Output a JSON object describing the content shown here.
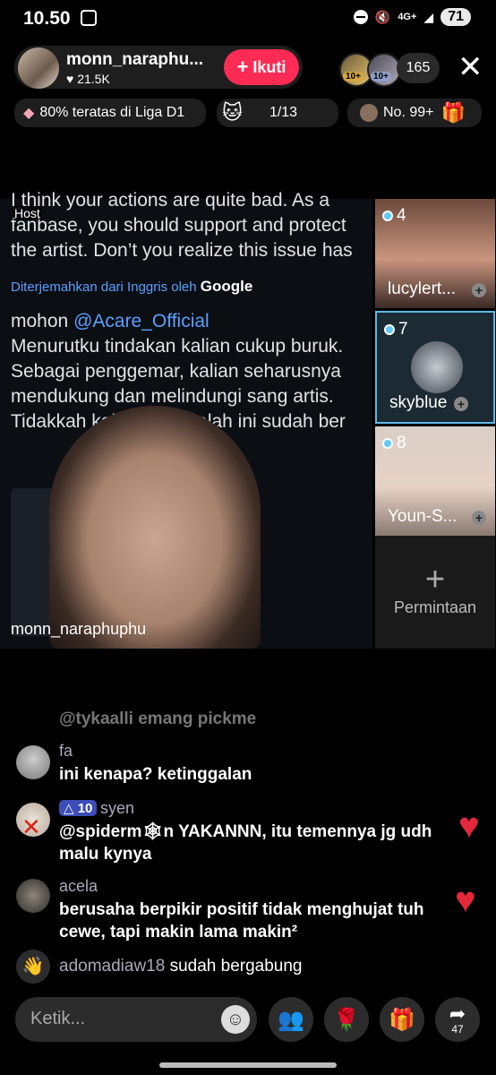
{
  "status_bar": {
    "time": "10.50",
    "signal": "4G+",
    "battery": "71"
  },
  "host": {
    "name": "monn_naraphu...",
    "likes": "21.5K",
    "follow_label": "Ikuti",
    "viewer_count": "165",
    "viewer_badge": "10+"
  },
  "chips": {
    "league": "80% teratas di Liga D1",
    "rank_progress": "1/13",
    "rank": "No. 99+"
  },
  "stream": {
    "host_label": "Host",
    "tweet_en": "I think your actions are quite bad. As a fanbase, you should support and protect the artist. Don’t you realize this issue has been going on for a long time?",
    "translated_by": "Diterjemahkan dari Inggris oleh",
    "google": "Google",
    "reply_prefix": "mohon",
    "mention": "@Acare_Official",
    "tweet_id": "Menurutku tindakan kalian cukup buruk. Sebagai penggemar, kalian seharusnya mendukung dan melindungi sang artis. Tidakkah kali dari masalah ini sudah ber",
    "streamer_name": "monn_naraphuphu"
  },
  "guests": [
    {
      "num": "4",
      "name": "lucylert..."
    },
    {
      "num": "7",
      "name": "skyblue"
    },
    {
      "num": "8",
      "name": "Youn-S..."
    }
  ],
  "request": {
    "label": "Permintaan"
  },
  "chat": {
    "partial": "@tykaalli emang pickme",
    "messages": [
      {
        "user": "fa",
        "text": "ini kenapa? ketinggalan"
      },
      {
        "badge": "10",
        "user": "syen",
        "text": "@spiderm🕸n YAKANNN, itu temennya jg udh malu kynya"
      },
      {
        "user": "acela",
        "text": "berusaha berpikir positif tidak menghujat tuh cewe, tapi makin lama makin²"
      }
    ],
    "join_user": "adomadiaw18",
    "join_text": "sudah bergabung"
  },
  "bottom": {
    "placeholder": "Ketik...",
    "share_count": "47"
  }
}
